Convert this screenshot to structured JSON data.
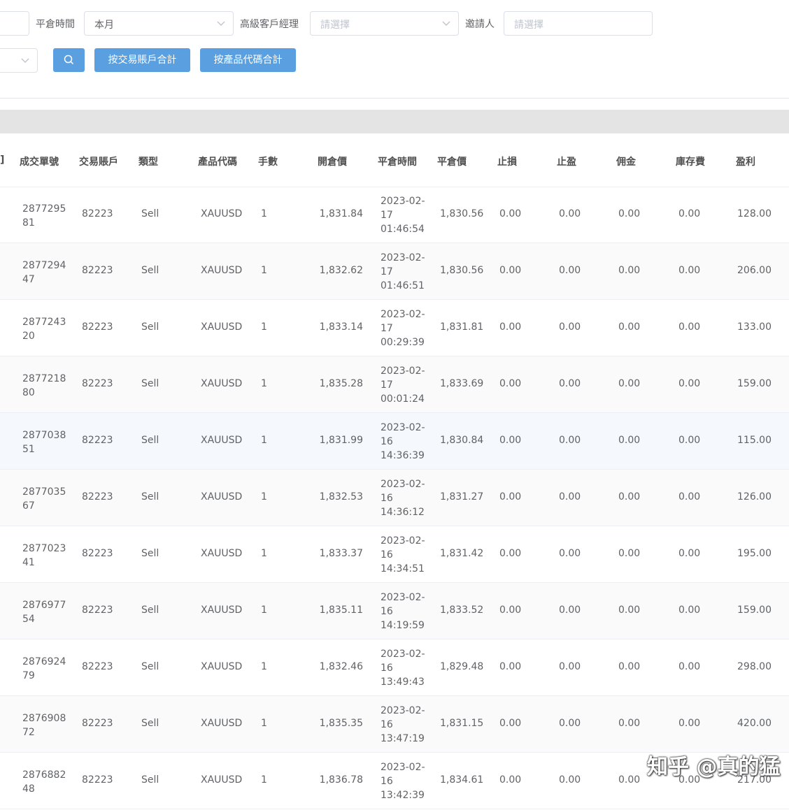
{
  "filters": {
    "close_time_label": "平倉時間",
    "close_time_value": "本月",
    "senior_manager_label": "高級客戶經理",
    "senior_manager_placeholder": "請選擇",
    "inviter_label": "邀請人",
    "inviter_placeholder": "請選擇",
    "sum_by_account_label": "按交易賬戶合計",
    "sum_by_product_label": "按產品代碼合計"
  },
  "table": {
    "headers": [
      "成交單號",
      "交易賬戶",
      "類型",
      "產品代碼",
      "手數",
      "開倉價",
      "平倉時間",
      "平倉價",
      "止損",
      "止盈",
      "佣金",
      "庫存費",
      "盈利"
    ],
    "rows": [
      {
        "order_l1": "2877295",
        "order_l2": "81",
        "account": "82223",
        "type": "Sell",
        "symbol": "XAUUSD",
        "lots": "1",
        "open_price": "1,831.84",
        "date": "2023-02-",
        "day": "17",
        "time": "01:46:54",
        "close_price": "1,830.56",
        "sl": "0.00",
        "tp": "0.00",
        "commission": "0.00",
        "swap": "0.00",
        "profit": "128.00"
      },
      {
        "order_l1": "2877294",
        "order_l2": "47",
        "account": "82223",
        "type": "Sell",
        "symbol": "XAUUSD",
        "lots": "1",
        "open_price": "1,832.62",
        "date": "2023-02-",
        "day": "17",
        "time": "01:46:51",
        "close_price": "1,830.56",
        "sl": "0.00",
        "tp": "0.00",
        "commission": "0.00",
        "swap": "0.00",
        "profit": "206.00"
      },
      {
        "order_l1": "2877243",
        "order_l2": "20",
        "account": "82223",
        "type": "Sell",
        "symbol": "XAUUSD",
        "lots": "1",
        "open_price": "1,833.14",
        "date": "2023-02-",
        "day": "17",
        "time": "00:29:39",
        "close_price": "1,831.81",
        "sl": "0.00",
        "tp": "0.00",
        "commission": "0.00",
        "swap": "0.00",
        "profit": "133.00"
      },
      {
        "order_l1": "2877218",
        "order_l2": "80",
        "account": "82223",
        "type": "Sell",
        "symbol": "XAUUSD",
        "lots": "1",
        "open_price": "1,835.28",
        "date": "2023-02-",
        "day": "17",
        "time": "00:01:24",
        "close_price": "1,833.69",
        "sl": "0.00",
        "tp": "0.00",
        "commission": "0.00",
        "swap": "0.00",
        "profit": "159.00"
      },
      {
        "order_l1": "2877038",
        "order_l2": "51",
        "account": "82223",
        "type": "Sell",
        "symbol": "XAUUSD",
        "lots": "1",
        "open_price": "1,831.99",
        "date": "2023-02-",
        "day": "16",
        "time": "14:36:39",
        "close_price": "1,830.84",
        "sl": "0.00",
        "tp": "0.00",
        "commission": "0.00",
        "swap": "0.00",
        "profit": "115.00"
      },
      {
        "order_l1": "2877035",
        "order_l2": "67",
        "account": "82223",
        "type": "Sell",
        "symbol": "XAUUSD",
        "lots": "1",
        "open_price": "1,832.53",
        "date": "2023-02-",
        "day": "16",
        "time": "14:36:12",
        "close_price": "1,831.27",
        "sl": "0.00",
        "tp": "0.00",
        "commission": "0.00",
        "swap": "0.00",
        "profit": "126.00"
      },
      {
        "order_l1": "2877023",
        "order_l2": "41",
        "account": "82223",
        "type": "Sell",
        "symbol": "XAUUSD",
        "lots": "1",
        "open_price": "1,833.37",
        "date": "2023-02-",
        "day": "16",
        "time": "14:34:51",
        "close_price": "1,831.42",
        "sl": "0.00",
        "tp": "0.00",
        "commission": "0.00",
        "swap": "0.00",
        "profit": "195.00"
      },
      {
        "order_l1": "2876977",
        "order_l2": "54",
        "account": "82223",
        "type": "Sell",
        "symbol": "XAUUSD",
        "lots": "1",
        "open_price": "1,835.11",
        "date": "2023-02-",
        "day": "16",
        "time": "14:19:59",
        "close_price": "1,833.52",
        "sl": "0.00",
        "tp": "0.00",
        "commission": "0.00",
        "swap": "0.00",
        "profit": "159.00"
      },
      {
        "order_l1": "2876924",
        "order_l2": "79",
        "account": "82223",
        "type": "Sell",
        "symbol": "XAUUSD",
        "lots": "1",
        "open_price": "1,832.46",
        "date": "2023-02-",
        "day": "16",
        "time": "13:49:43",
        "close_price": "1,829.48",
        "sl": "0.00",
        "tp": "0.00",
        "commission": "0.00",
        "swap": "0.00",
        "profit": "298.00"
      },
      {
        "order_l1": "2876908",
        "order_l2": "72",
        "account": "82223",
        "type": "Sell",
        "symbol": "XAUUSD",
        "lots": "1",
        "open_price": "1,835.35",
        "date": "2023-02-",
        "day": "16",
        "time": "13:47:19",
        "close_price": "1,831.15",
        "sl": "0.00",
        "tp": "0.00",
        "commission": "0.00",
        "swap": "0.00",
        "profit": "420.00"
      },
      {
        "order_l1": "2876882",
        "order_l2": "48",
        "account": "82223",
        "type": "Sell",
        "symbol": "XAUUSD",
        "lots": "1",
        "open_price": "1,836.78",
        "date": "2023-02-",
        "day": "16",
        "time": "13:42:39",
        "close_price": "1,834.61",
        "sl": "0.00",
        "tp": "0.00",
        "commission": "0.00",
        "swap": "0.00",
        "profit": "217.00"
      }
    ]
  },
  "watermark": "知乎 @真的猛",
  "icons": {
    "search": "search-icon",
    "dropdown": "chevron-down-icon"
  },
  "colors": {
    "primary_button": "#5a9fe0",
    "header_bar": "#e4e4e4"
  }
}
